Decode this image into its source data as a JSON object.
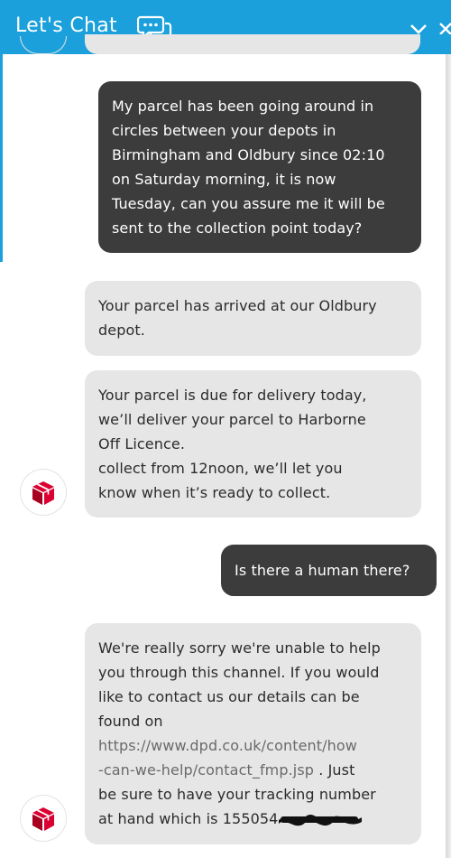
{
  "header": {
    "title": "Let's Chat",
    "chat_icon": "chat-bubbles-icon",
    "minimize_icon": "chevron-down-icon",
    "close_icon": "close-icon",
    "background_color": "#1ba0dc"
  },
  "colors": {
    "user_bubble": "#3c3c3c",
    "bot_bubble": "#e6e6e6",
    "brand_red": "#dc0032"
  },
  "messages": [
    {
      "sender": "user",
      "lines": [
        "My parcel has been going around in",
        "circles between your depots in",
        "Birmingham and Oldbury since 02:10",
        "on Saturday morning, it is now",
        "Tuesday, can you assure me it will be",
        "sent to the collection point today?"
      ]
    },
    {
      "sender": "bot",
      "lines": [
        "Your parcel has arrived at our Oldbury",
        "depot."
      ]
    },
    {
      "sender": "bot",
      "lines": [
        "Your parcel is due for delivery today,",
        "we’ll deliver your parcel to Harborne",
        "Off Licence.",
        "collect from 12noon, we’ll let you",
        "know when it’s ready to collect."
      ]
    },
    {
      "sender": "user",
      "lines": [
        "Is there a human there?"
      ]
    },
    {
      "sender": "bot",
      "lines": [
        "We're really sorry we're unable to help",
        "you through this channel. If you would",
        "like to contact us our details can be",
        "found on"
      ],
      "link_lines": [
        "https://www.dpd.co.uk/content/how",
        "-can-we-help/contact_fmp.jsp"
      ],
      "after_link": " . Just",
      "tail_lines": [
        "be sure to have your tracking number",
        "at hand which is 155054"
      ]
    }
  ],
  "avatar_icon": "dpd-parcel-box-icon"
}
